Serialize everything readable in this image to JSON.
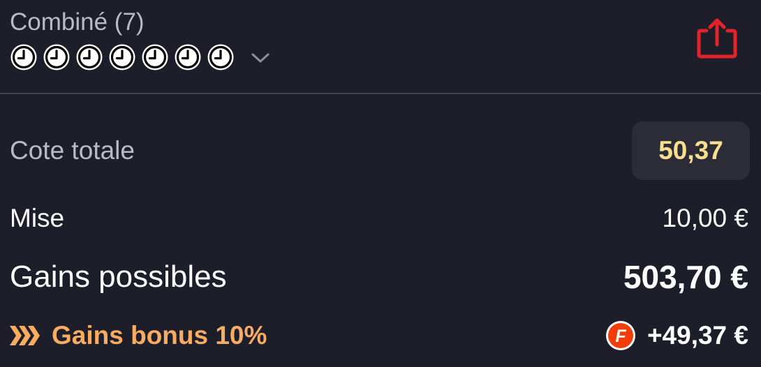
{
  "header": {
    "bet_type": "Combiné (7)",
    "selection_count": 7,
    "selection_status_icon": "clock-icon",
    "expand_icon": "chevron-down-icon",
    "share_icon": "share-icon"
  },
  "odds": {
    "label": "Cote totale",
    "value": "50,37"
  },
  "stake": {
    "label": "Mise",
    "value": "10,00 €"
  },
  "potential_gains": {
    "label": "Gains possibles",
    "value": "503,70 €"
  },
  "bonus": {
    "icon": "chevrons-right-icon",
    "label": "Gains bonus 10%",
    "badge_icon": "freebet-badge-icon",
    "badge_letter": "F",
    "value": "+49,37 €"
  },
  "colors": {
    "background": "#1e1e2b",
    "divider": "#41414f",
    "muted_text": "#bbbac3",
    "odds_pill": "#2c2c39",
    "odds_text": "#f8de8e",
    "bonus_orange": "#f8ac62",
    "share_red": "#e2232a",
    "badge_red": "#f23d0a"
  }
}
